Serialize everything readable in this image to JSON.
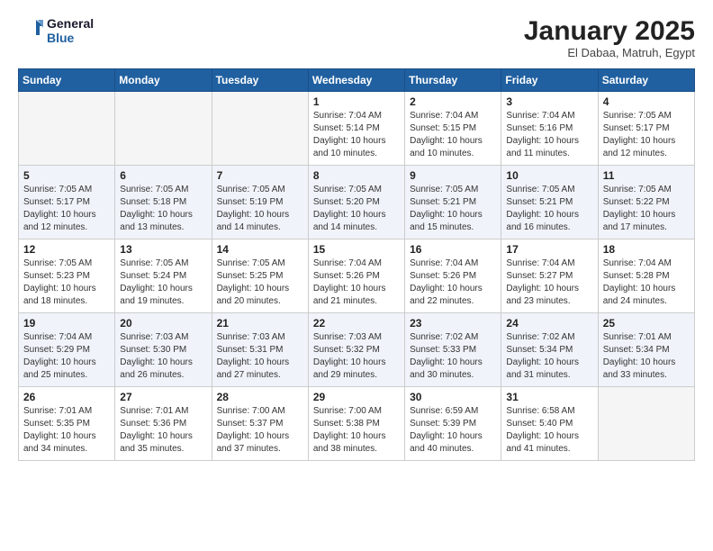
{
  "header": {
    "logo_line1": "General",
    "logo_line2": "Blue",
    "month": "January 2025",
    "location": "El Dabaa, Matruh, Egypt"
  },
  "weekdays": [
    "Sunday",
    "Monday",
    "Tuesday",
    "Wednesday",
    "Thursday",
    "Friday",
    "Saturday"
  ],
  "weeks": [
    [
      {
        "day": "",
        "info": ""
      },
      {
        "day": "",
        "info": ""
      },
      {
        "day": "",
        "info": ""
      },
      {
        "day": "1",
        "info": "Sunrise: 7:04 AM\nSunset: 5:14 PM\nDaylight: 10 hours\nand 10 minutes."
      },
      {
        "day": "2",
        "info": "Sunrise: 7:04 AM\nSunset: 5:15 PM\nDaylight: 10 hours\nand 10 minutes."
      },
      {
        "day": "3",
        "info": "Sunrise: 7:04 AM\nSunset: 5:16 PM\nDaylight: 10 hours\nand 11 minutes."
      },
      {
        "day": "4",
        "info": "Sunrise: 7:05 AM\nSunset: 5:17 PM\nDaylight: 10 hours\nand 12 minutes."
      }
    ],
    [
      {
        "day": "5",
        "info": "Sunrise: 7:05 AM\nSunset: 5:17 PM\nDaylight: 10 hours\nand 12 minutes."
      },
      {
        "day": "6",
        "info": "Sunrise: 7:05 AM\nSunset: 5:18 PM\nDaylight: 10 hours\nand 13 minutes."
      },
      {
        "day": "7",
        "info": "Sunrise: 7:05 AM\nSunset: 5:19 PM\nDaylight: 10 hours\nand 14 minutes."
      },
      {
        "day": "8",
        "info": "Sunrise: 7:05 AM\nSunset: 5:20 PM\nDaylight: 10 hours\nand 14 minutes."
      },
      {
        "day": "9",
        "info": "Sunrise: 7:05 AM\nSunset: 5:21 PM\nDaylight: 10 hours\nand 15 minutes."
      },
      {
        "day": "10",
        "info": "Sunrise: 7:05 AM\nSunset: 5:21 PM\nDaylight: 10 hours\nand 16 minutes."
      },
      {
        "day": "11",
        "info": "Sunrise: 7:05 AM\nSunset: 5:22 PM\nDaylight: 10 hours\nand 17 minutes."
      }
    ],
    [
      {
        "day": "12",
        "info": "Sunrise: 7:05 AM\nSunset: 5:23 PM\nDaylight: 10 hours\nand 18 minutes."
      },
      {
        "day": "13",
        "info": "Sunrise: 7:05 AM\nSunset: 5:24 PM\nDaylight: 10 hours\nand 19 minutes."
      },
      {
        "day": "14",
        "info": "Sunrise: 7:05 AM\nSunset: 5:25 PM\nDaylight: 10 hours\nand 20 minutes."
      },
      {
        "day": "15",
        "info": "Sunrise: 7:04 AM\nSunset: 5:26 PM\nDaylight: 10 hours\nand 21 minutes."
      },
      {
        "day": "16",
        "info": "Sunrise: 7:04 AM\nSunset: 5:26 PM\nDaylight: 10 hours\nand 22 minutes."
      },
      {
        "day": "17",
        "info": "Sunrise: 7:04 AM\nSunset: 5:27 PM\nDaylight: 10 hours\nand 23 minutes."
      },
      {
        "day": "18",
        "info": "Sunrise: 7:04 AM\nSunset: 5:28 PM\nDaylight: 10 hours\nand 24 minutes."
      }
    ],
    [
      {
        "day": "19",
        "info": "Sunrise: 7:04 AM\nSunset: 5:29 PM\nDaylight: 10 hours\nand 25 minutes."
      },
      {
        "day": "20",
        "info": "Sunrise: 7:03 AM\nSunset: 5:30 PM\nDaylight: 10 hours\nand 26 minutes."
      },
      {
        "day": "21",
        "info": "Sunrise: 7:03 AM\nSunset: 5:31 PM\nDaylight: 10 hours\nand 27 minutes."
      },
      {
        "day": "22",
        "info": "Sunrise: 7:03 AM\nSunset: 5:32 PM\nDaylight: 10 hours\nand 29 minutes."
      },
      {
        "day": "23",
        "info": "Sunrise: 7:02 AM\nSunset: 5:33 PM\nDaylight: 10 hours\nand 30 minutes."
      },
      {
        "day": "24",
        "info": "Sunrise: 7:02 AM\nSunset: 5:34 PM\nDaylight: 10 hours\nand 31 minutes."
      },
      {
        "day": "25",
        "info": "Sunrise: 7:01 AM\nSunset: 5:34 PM\nDaylight: 10 hours\nand 33 minutes."
      }
    ],
    [
      {
        "day": "26",
        "info": "Sunrise: 7:01 AM\nSunset: 5:35 PM\nDaylight: 10 hours\nand 34 minutes."
      },
      {
        "day": "27",
        "info": "Sunrise: 7:01 AM\nSunset: 5:36 PM\nDaylight: 10 hours\nand 35 minutes."
      },
      {
        "day": "28",
        "info": "Sunrise: 7:00 AM\nSunset: 5:37 PM\nDaylight: 10 hours\nand 37 minutes."
      },
      {
        "day": "29",
        "info": "Sunrise: 7:00 AM\nSunset: 5:38 PM\nDaylight: 10 hours\nand 38 minutes."
      },
      {
        "day": "30",
        "info": "Sunrise: 6:59 AM\nSunset: 5:39 PM\nDaylight: 10 hours\nand 40 minutes."
      },
      {
        "day": "31",
        "info": "Sunrise: 6:58 AM\nSunset: 5:40 PM\nDaylight: 10 hours\nand 41 minutes."
      },
      {
        "day": "",
        "info": ""
      }
    ]
  ]
}
